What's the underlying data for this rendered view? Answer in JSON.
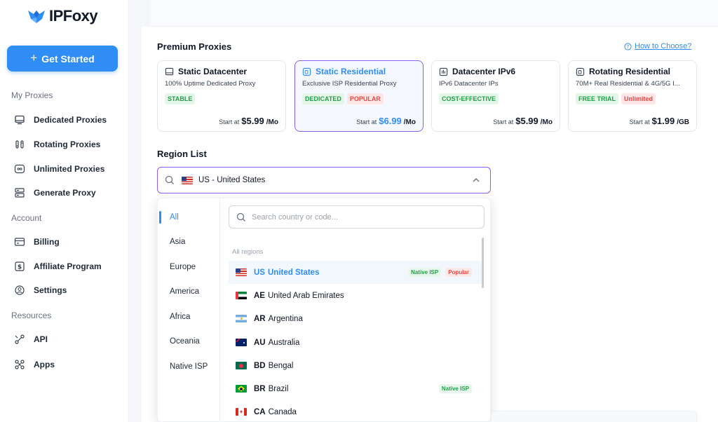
{
  "brand": {
    "name": "IPFoxy"
  },
  "sidebar": {
    "cta": {
      "icon": "plus-icon",
      "label": "Get Started"
    },
    "sections": {
      "proxies": "My Proxies",
      "account": "Account",
      "resources": "Resources"
    },
    "items": [
      {
        "label": "Dedicated Proxies",
        "icon": "monitor-icon"
      },
      {
        "label": "Rotating Proxies",
        "icon": "rotate-icon"
      },
      {
        "label": "Unlimited Proxies",
        "icon": "infinity-icon"
      },
      {
        "label": "Generate Proxy",
        "icon": "server-icon"
      },
      {
        "label": "Billing",
        "icon": "billing-icon"
      },
      {
        "label": "Affiliate Program",
        "icon": "dollar-icon"
      },
      {
        "label": "Settings",
        "icon": "gear-icon"
      },
      {
        "label": "API",
        "icon": "api-icon"
      },
      {
        "label": "Apps",
        "icon": "apps-icon"
      }
    ]
  },
  "main": {
    "premium_title": "Premium Proxies",
    "how_to_choose": "How to Choose?",
    "cards": [
      {
        "title": "Static Datacenter",
        "desc": "100% Uptime Dedicated Proxy",
        "tags": [
          "STABLE"
        ],
        "start_label": "Start at",
        "price": "$5.99",
        "unit": "/Mo",
        "active": false
      },
      {
        "title": "Static Residential",
        "desc": "Exclusive ISP Residential Proxy",
        "tags": [
          "DEDICATED",
          "POPULAR"
        ],
        "start_label": "Start at",
        "price": "$6.99",
        "unit": "/Mo",
        "active": true
      },
      {
        "title": "Datacenter IPv6",
        "desc": "IPv6 Datacenter IPs",
        "tags": [
          "COST-EFFECTIVE"
        ],
        "start_label": "Start at",
        "price": "$5.99",
        "unit": "/Mo",
        "active": false
      },
      {
        "title": "Rotating Residential",
        "desc": "70M+ Real Residential & 4G/5G I...",
        "tags": [
          "FREE TRIAL",
          "Unlimited"
        ],
        "start_label": "Start at",
        "price": "$1.99",
        "unit": "/GB",
        "active": false
      }
    ],
    "region_title": "Region List",
    "region_select": {
      "value": "US - United States"
    },
    "dropdown": {
      "tabs": [
        "All",
        "Asia",
        "Europe",
        "America",
        "Africa",
        "Oceania",
        "Native ISP"
      ],
      "active_tab": "All",
      "search_placeholder": "Search country or code...",
      "group_label": "All regions",
      "countries": [
        {
          "code": "US",
          "name": "United States",
          "badges": [
            "Native ISP",
            "Popular"
          ],
          "selected": true
        },
        {
          "code": "AE",
          "name": "United Arab Emirates",
          "badges": []
        },
        {
          "code": "AR",
          "name": "Argentina",
          "badges": []
        },
        {
          "code": "AU",
          "name": "Australia",
          "badges": []
        },
        {
          "code": "BD",
          "name": "Bengal",
          "badges": []
        },
        {
          "code": "BR",
          "name": "Brazil",
          "badges": [
            "Native ISP"
          ]
        },
        {
          "code": "CA",
          "name": "Canada",
          "badges": []
        }
      ]
    }
  },
  "colors": {
    "accent": "#2f8df5",
    "focus": "#8b5cf6",
    "green": "#22a04a",
    "red": "#ef4444"
  }
}
